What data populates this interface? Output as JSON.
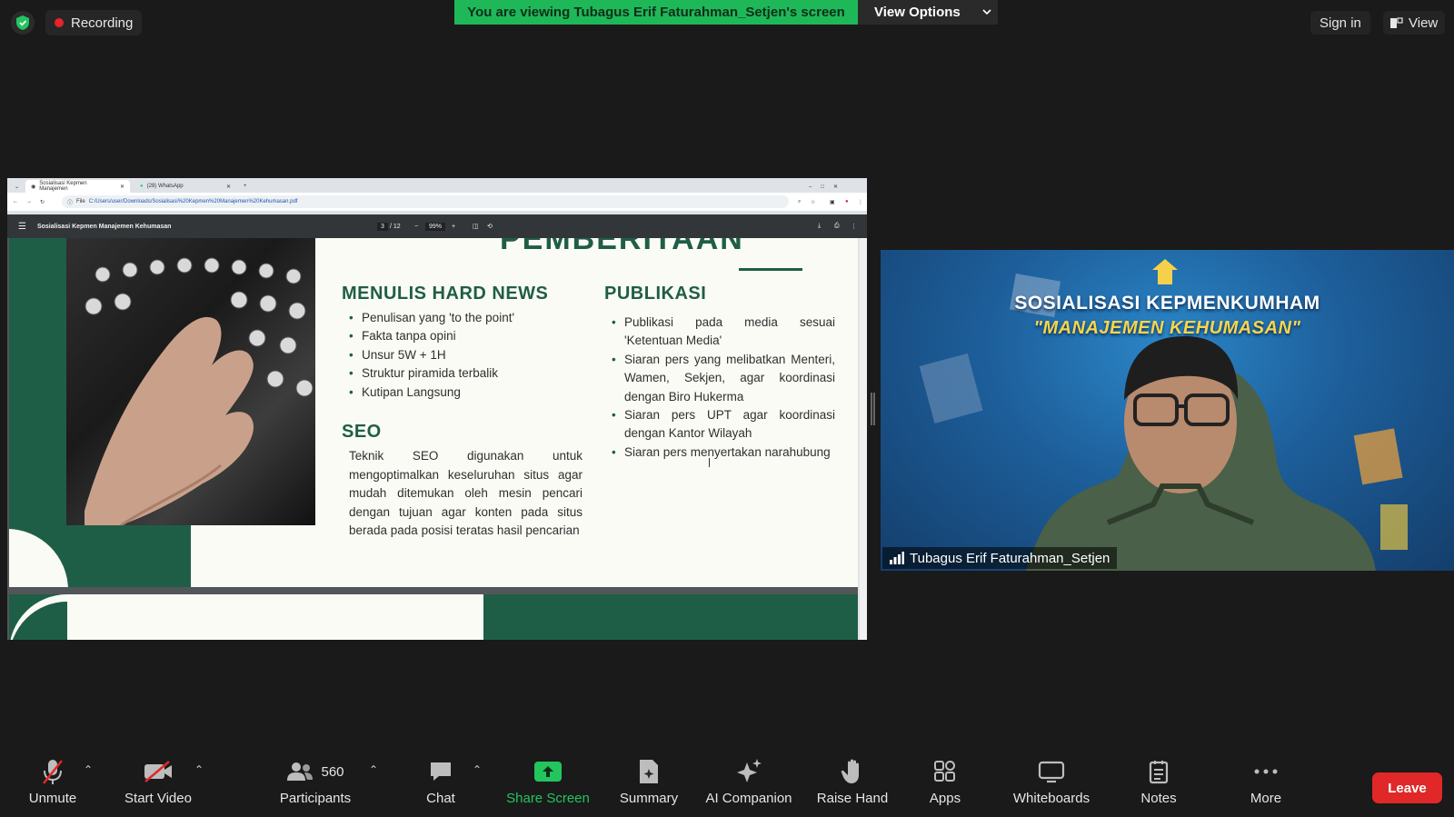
{
  "top": {
    "recording_label": "Recording",
    "viewing_banner": "You are viewing Tubagus Erif Faturahman_Setjen's screen",
    "view_options_label": "View Options",
    "sign_in_label": "Sign in",
    "view_label": "View"
  },
  "browser": {
    "tab1": "Sosialisasi Kepmen Manajemen",
    "tab2": "(28) WhatsApp",
    "url_prefix": "File",
    "url": "C:/Users/user/Downloads/Sosialisasi%20Kepmen%20Manajemen%20Kehumasan.pdf",
    "pdf_title": "Sosialisasi Kepmen Manajemen Kehumasan",
    "page_current": "3",
    "page_total": "/ 12",
    "zoom": "99%"
  },
  "slide": {
    "top_heading": "PEMBERITAAN",
    "col1_title": "MENULIS HARD NEWS",
    "col1_items": [
      "Penulisan yang 'to the point'",
      "Fakta tanpa opini",
      "Unsur 5W + 1H",
      "Struktur piramida terbalik",
      "Kutipan Langsung"
    ],
    "seo_title": "SEO",
    "seo_text": "Teknik SEO digunakan untuk mengoptimalkan keseluruhan situs agar mudah ditemukan oleh mesin pencari dengan tujuan agar konten pada situs berada pada posisi teratas hasil pencarian",
    "col2_title": "PUBLIKASI",
    "col2_items": [
      "Publikasi pada media sesuai 'Ketentuan Media'",
      "Siaran pers yang melibatkan Menteri, Wamen, Sekjen, agar koordinasi dengan Biro Hukerma",
      "Siaran pers UPT agar koordinasi dengan Kantor Wilayah",
      "Siaran pers menyertakan narahubung"
    ]
  },
  "video": {
    "banner_line1": "SOSIALISASI KEPMENKUMHAM",
    "banner_line2": "\"MANAJEMEN KEHUMASAN\"",
    "participant_name": "Tubagus Erif Faturahman_Setjen"
  },
  "toolbar": {
    "unmute": "Unmute",
    "start_video": "Start Video",
    "participants_count": "560",
    "participants": "Participants",
    "chat": "Chat",
    "share_screen": "Share Screen",
    "summary": "Summary",
    "ai_companion": "AI Companion",
    "raise_hand": "Raise Hand",
    "apps": "Apps",
    "whiteboards": "Whiteboards",
    "notes": "Notes",
    "more": "More",
    "leave": "Leave"
  },
  "colors": {
    "banner_green": "#1fb859",
    "slide_green": "#1f5e46",
    "leave_red": "#e02828",
    "share_green": "#22c55e"
  }
}
